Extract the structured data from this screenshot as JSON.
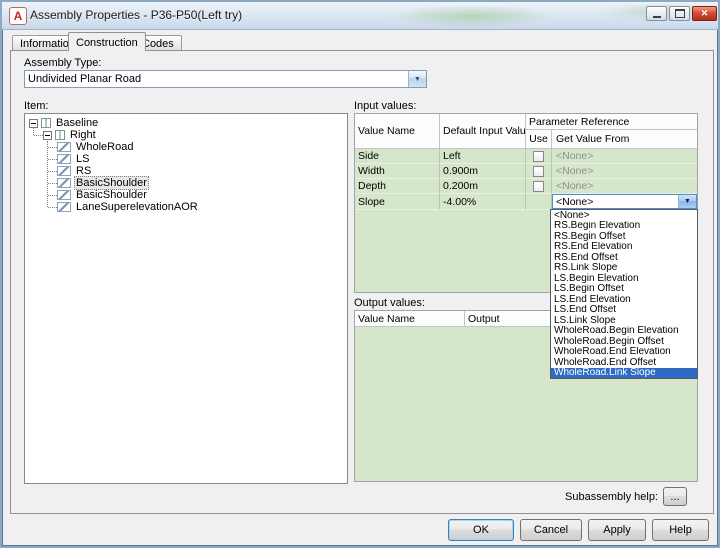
{
  "colors": {
    "table_green": "#d5e6cb",
    "selection_blue": "#2e6bc5",
    "close_red": "#c23b27"
  },
  "window": {
    "title": "Assembly Properties - P36-P50(Left try)"
  },
  "icons": {
    "app": "A",
    "close": "✕",
    "dropdown_arrow": "▼"
  },
  "tabs": {
    "items": [
      {
        "label": "Information"
      },
      {
        "label": "Construction"
      },
      {
        "label": "Codes"
      }
    ],
    "active": "Construction"
  },
  "assembly_type": {
    "label": "Assembly Type:",
    "value": "Undivided Planar Road"
  },
  "tree": {
    "label": "Item:",
    "root": "Baseline",
    "branch": "Right",
    "leaves": [
      "WholeRoad",
      "LS",
      "RS",
      "BasicShoulder",
      "BasicShoulder",
      "LaneSuperelevationAOR"
    ],
    "selected": "BasicShoulder",
    "selected_index": 3
  },
  "input_values": {
    "label": "Input values:",
    "columns": {
      "name": "Value Name",
      "default": "Default Input Value",
      "param_ref": "Parameter Reference",
      "use": "Use",
      "get_value": "Get Value From"
    },
    "rows": [
      {
        "name": "Side",
        "default": "Left",
        "use_checked": false,
        "get_value": "<None>"
      },
      {
        "name": "Width",
        "default": "0.900m",
        "use_checked": false,
        "get_value": "<None>"
      },
      {
        "name": "Depth",
        "default": "0.200m",
        "use_checked": false,
        "get_value": "<None>"
      },
      {
        "name": "Slope",
        "default": "-4.00%"
      }
    ]
  },
  "slope_dropdown": {
    "value": "<None>",
    "options": [
      "<None>",
      "RS.Begin Elevation",
      "RS.Begin Offset",
      "RS.End Elevation",
      "RS.End Offset",
      "RS.Link Slope",
      "LS.Begin Elevation",
      "LS.Begin Offset",
      "LS.End Elevation",
      "LS.End Offset",
      "LS.Link Slope",
      "WholeRoad.Begin Elevation",
      "WholeRoad.Begin Offset",
      "WholeRoad.End Elevation",
      "WholeRoad.End Offset",
      "WholeRoad.Link Slope"
    ],
    "highlighted": "WholeRoad.Link Slope",
    "highlighted_index": 15
  },
  "output_values": {
    "label": "Output values:",
    "columns": {
      "name": "Value Name",
      "output": "Output"
    }
  },
  "help": {
    "label": "Subassembly help:",
    "button": "..."
  },
  "footer": {
    "ok": "OK",
    "cancel": "Cancel",
    "apply": "Apply",
    "help": "Help"
  }
}
